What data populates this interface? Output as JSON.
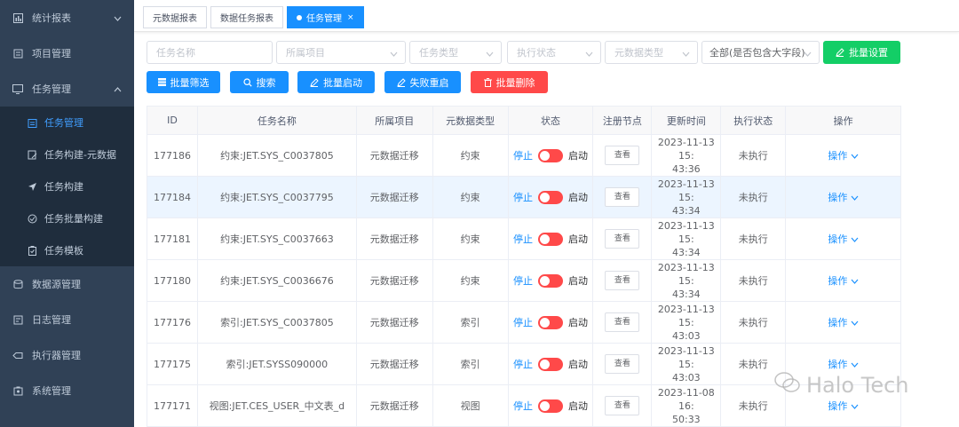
{
  "sidebar": {
    "items": [
      {
        "label": "统计报表",
        "icon": "chart-icon",
        "expanded": false
      },
      {
        "label": "项目管理",
        "icon": "project-icon"
      },
      {
        "label": "任务管理",
        "icon": "monitor-icon",
        "expanded": true
      },
      {
        "label": "数据源管理",
        "icon": "database-icon"
      },
      {
        "label": "日志管理",
        "icon": "log-icon"
      },
      {
        "label": "执行器管理",
        "icon": "executor-icon"
      },
      {
        "label": "系统管理",
        "icon": "system-icon"
      }
    ],
    "sub_items": [
      {
        "label": "任务管理",
        "icon": "task-icon",
        "active": true
      },
      {
        "label": "任务构建-元数据",
        "icon": "edit-icon"
      },
      {
        "label": "任务构建",
        "icon": "send-icon"
      },
      {
        "label": "任务批量构建",
        "icon": "batch-icon"
      },
      {
        "label": "任务模板",
        "icon": "template-icon"
      }
    ]
  },
  "tags": [
    {
      "label": "元数据报表"
    },
    {
      "label": "数据任务报表"
    },
    {
      "label": "任务管理",
      "active": true,
      "close": "×"
    }
  ],
  "filters": {
    "task_name_placeholder": "任务名称",
    "project_placeholder": "所属项目",
    "task_type_placeholder": "任务类型",
    "exec_status_placeholder": "执行状态",
    "metadata_type_placeholder": "元数据类型",
    "big_field_value": "全部(是否包含大字段)"
  },
  "buttons": {
    "batch_settings": "批量设置",
    "batch_filter": "批量筛选",
    "search": "搜索",
    "batch_start": "批量启动",
    "fail_restart": "失败重启",
    "batch_delete": "批量删除"
  },
  "table": {
    "headers": [
      "ID",
      "任务名称",
      "所属项目",
      "元数据类型",
      "状态",
      "注册节点",
      "更新时间",
      "执行状态",
      "操作"
    ],
    "stop_label": "停止",
    "start_label": "启动",
    "view_label": "查看",
    "op_label": "操作",
    "rows": [
      {
        "id": "177186",
        "name": "约束:JET.SYS_C0037805",
        "project": "元数据迁移",
        "type": "约束",
        "time1": "2023-11-13 15:",
        "time2": "43:36",
        "exec": "未执行"
      },
      {
        "id": "177184",
        "name": "约束:JET.SYS_C0037795",
        "project": "元数据迁移",
        "type": "约束",
        "time1": "2023-11-13 15:",
        "time2": "43:34",
        "exec": "未执行"
      },
      {
        "id": "177181",
        "name": "约束:JET.SYS_C0037663",
        "project": "元数据迁移",
        "type": "约束",
        "time1": "2023-11-13 15:",
        "time2": "43:34",
        "exec": "未执行"
      },
      {
        "id": "177180",
        "name": "约束:JET.SYS_C0036676",
        "project": "元数据迁移",
        "type": "约束",
        "time1": "2023-11-13 15:",
        "time2": "43:34",
        "exec": "未执行"
      },
      {
        "id": "177176",
        "name": "索引:JET.SYS_C0037805",
        "project": "元数据迁移",
        "type": "索引",
        "time1": "2023-11-13 15:",
        "time2": "43:03",
        "exec": "未执行"
      },
      {
        "id": "177175",
        "name": "索引:JET.SYSS090000",
        "project": "元数据迁移",
        "type": "索引",
        "time1": "2023-11-13 15:",
        "time2": "43:03",
        "exec": "未执行"
      },
      {
        "id": "177171",
        "name": "视图:JET.CES_USER_中文表_d",
        "project": "元数据迁移",
        "type": "视图",
        "time1": "2023-11-08 16:",
        "time2": "50:33",
        "exec": "未执行"
      }
    ]
  },
  "watermark": "Halo Tech",
  "colors": {
    "primary": "#1890ff",
    "success": "#13ce66",
    "danger": "#ff4949",
    "sidebar": "#304156"
  }
}
